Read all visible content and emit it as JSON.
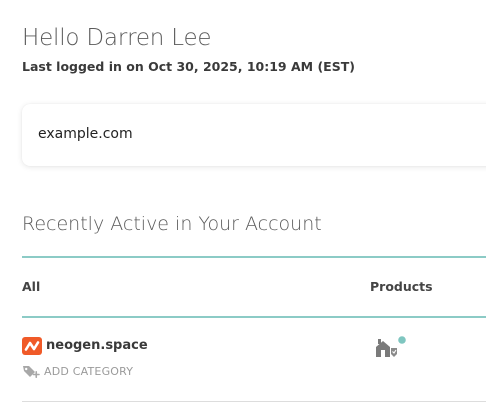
{
  "header": {
    "greeting": "Hello Darren Lee",
    "last_login": "Last logged in on Oct 30, 2025, 10:19 AM (EST)"
  },
  "domain_card": {
    "value": "example.com"
  },
  "activity": {
    "title": "Recently Active in Your Account",
    "columns": {
      "all": "All",
      "products": "Products"
    },
    "rows": [
      {
        "domain": "neogen.space",
        "add_category_label": "ADD CATEGORY",
        "product_icon": "hosting-icon"
      }
    ]
  },
  "colors": {
    "accent_teal": "#8ccbc6",
    "brand_orange": "#f05a28"
  }
}
